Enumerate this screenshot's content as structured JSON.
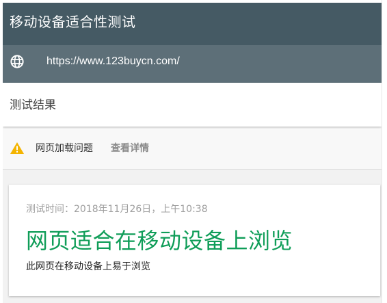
{
  "header": {
    "title": "移动设备适合性测试"
  },
  "url_bar": {
    "icon": "globe-icon",
    "url": "https://www.123buycn.com/"
  },
  "results": {
    "title": "测试结果"
  },
  "issue": {
    "icon": "warning-icon",
    "label": "网页加载问题",
    "link": "查看详情",
    "warning_color": "#f4b400"
  },
  "result_card": {
    "test_time": "测试时间：2018年11月26日，上午10:38",
    "heading": "网页适合在移动设备上浏览",
    "description": "此网页在移动设备上易于浏览",
    "heading_color": "#0f9d58"
  },
  "colors": {
    "title_bar": "#455a64",
    "url_bar": "#5d6f78"
  }
}
